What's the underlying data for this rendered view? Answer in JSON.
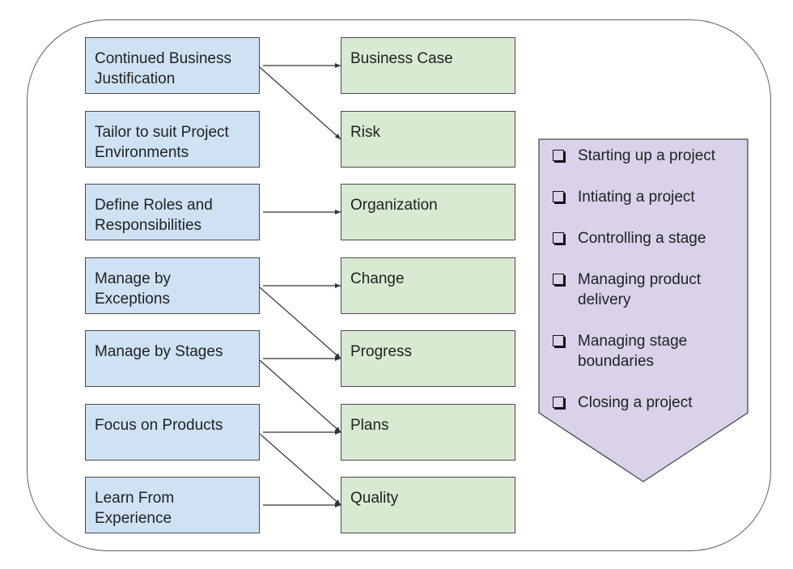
{
  "diagram": {
    "colors": {
      "principle_fill": "#cfe2f3",
      "theme_fill": "#d9ead3",
      "process_fill": "#d9d2e9",
      "stroke": "#4a4a4a"
    },
    "principles": [
      {
        "id": "p1",
        "label": "Continued Business\nJustification"
      },
      {
        "id": "p2",
        "label": "Tailor to suit Project\nEnvironments"
      },
      {
        "id": "p3",
        "label": "Define Roles and\nResponsibilities"
      },
      {
        "id": "p4",
        "label": "Manage by\nExceptions"
      },
      {
        "id": "p5",
        "label": "Manage by Stages"
      },
      {
        "id": "p6",
        "label": "Focus on Products"
      },
      {
        "id": "p7",
        "label": "Learn From\nExperience"
      }
    ],
    "themes": [
      {
        "id": "t1",
        "label": "Business Case"
      },
      {
        "id": "t2",
        "label": "Risk"
      },
      {
        "id": "t3",
        "label": "Organization"
      },
      {
        "id": "t4",
        "label": "Change"
      },
      {
        "id": "t5",
        "label": "Progress"
      },
      {
        "id": "t6",
        "label": "Plans"
      },
      {
        "id": "t7",
        "label": "Quality"
      }
    ],
    "connections": [
      {
        "from": "p1",
        "to": "t1"
      },
      {
        "from": "p1",
        "to": "t2"
      },
      {
        "from": "p3",
        "to": "t3"
      },
      {
        "from": "p4",
        "to": "t4"
      },
      {
        "from": "p4",
        "to": "t5"
      },
      {
        "from": "p5",
        "to": "t5"
      },
      {
        "from": "p5",
        "to": "t6"
      },
      {
        "from": "p6",
        "to": "t6"
      },
      {
        "from": "p6",
        "to": "t7"
      },
      {
        "from": "p7",
        "to": "t7"
      }
    ],
    "processes": [
      {
        "label": "Starting up a project"
      },
      {
        "label": "Intiating a project"
      },
      {
        "label": "Controlling a stage"
      },
      {
        "label": "Managing product\ndelivery"
      },
      {
        "label": "Managing stage\nboundaries"
      },
      {
        "label": "Closing a project"
      }
    ]
  }
}
